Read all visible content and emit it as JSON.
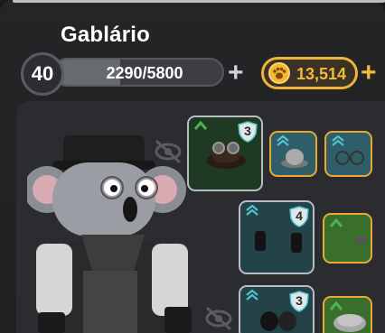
{
  "player": {
    "name": "Gablário",
    "level": "40"
  },
  "xp": {
    "text": "2290/5800",
    "current": 2290,
    "max": 5800
  },
  "coins": {
    "amount": "13,514"
  },
  "colors": {
    "gold": "#f0b43a",
    "cyan_arrow": "#4fc3cf",
    "green_arrow": "#4fb34f"
  },
  "items": [
    {
      "id": "goggles-hat",
      "frame": "grey",
      "level": "3",
      "arrow": "green-single"
    },
    {
      "id": "bowler-hat",
      "frame": "gold",
      "arrow": "cyan-double"
    },
    {
      "id": "round-glasses",
      "frame": "gold",
      "arrow": "cyan-double"
    },
    {
      "id": "dark-boots",
      "frame": "grey",
      "level": "4",
      "arrow": "cyan-double"
    },
    {
      "id": "green-item",
      "frame": "gold",
      "arrow": "green-single"
    },
    {
      "id": "dark-gloves",
      "frame": "grey",
      "level": "3",
      "arrow": "cyan-double"
    },
    {
      "id": "grey-cap",
      "frame": "gold",
      "arrow": "green-single"
    }
  ]
}
